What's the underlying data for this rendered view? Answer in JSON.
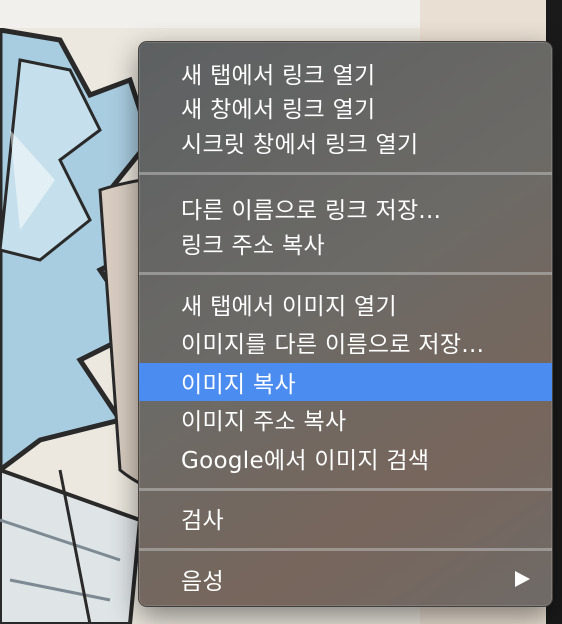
{
  "context_menu": {
    "items": [
      {
        "label": "새 탭에서 링크 열기"
      },
      {
        "label": "새 창에서 링크 열기"
      },
      {
        "label": "시크릿 창에서 링크 열기"
      },
      {
        "label": "다른 이름으로 링크 저장..."
      },
      {
        "label": "링크 주소 복사"
      },
      {
        "label": "새 탭에서 이미지 열기"
      },
      {
        "label": "이미지를 다른 이름으로 저장..."
      },
      {
        "label": "이미지 복사"
      },
      {
        "label": "이미지 주소 복사"
      },
      {
        "label": "Google에서 이미지 검색"
      },
      {
        "label": "검사"
      },
      {
        "label": "음성"
      }
    ],
    "highlighted_item": "이미지 복사",
    "highlight_color": "#4b8cf0",
    "submenu_icon": "triangle-right-icon"
  }
}
